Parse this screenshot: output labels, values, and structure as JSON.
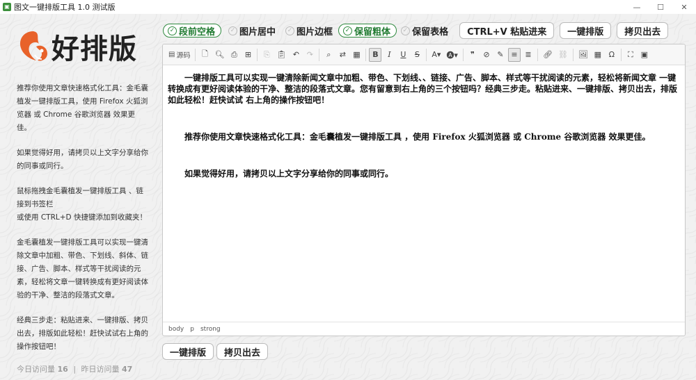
{
  "window": {
    "title": "图文一键排版工具 1.0 测试版",
    "minimize": "—",
    "maximize": "☐",
    "close": "✕"
  },
  "brand": {
    "logo_text": "好排版",
    "accent": "#e8622a"
  },
  "sidebar": {
    "paragraphs": [
      "推荐你使用文章快速格式化工具：金毛囊植发一键排版工具，使用 Firefox 火狐浏览器 或 Chrome 谷歌浏览器 效果更佳。",
      "如果觉得好用，请拷贝以上文字分享给你的同事或同行。",
      "鼠标拖拽金毛囊植发一键排版工具 、链接到书签栏\n或使用 CTRL+D 快捷键添加到收藏夹！",
      "金毛囊植发一键排版工具可以实现一键清除文章中加粗、带色、下划线、斜体、链接、广告、脚本、样式等干扰阅读的元素，轻松将文章一键转换成有更好阅读体验的干净、整洁的段落式文章。",
      "经典三步走：粘贴进来、一键排版、拷贝出去，排版如此轻松！赶快试试右上角的操作按钮吧！"
    ],
    "visits": {
      "today_label": "今日访问量",
      "today_value": "16",
      "separator": "|",
      "yesterday_label": "昨日访问量",
      "yesterday_value": "47"
    }
  },
  "options": [
    {
      "label": "段前空格",
      "checked": true
    },
    {
      "label": "图片居中",
      "checked": false
    },
    {
      "label": "图片边框",
      "checked": false
    },
    {
      "label": "保留粗体",
      "checked": true
    },
    {
      "label": "保留表格",
      "checked": false
    }
  ],
  "actions": {
    "paste": "CTRL+V 粘贴进来",
    "format": "一键排版",
    "copy": "拷贝出去"
  },
  "toolbar": {
    "source_label": "源码"
  },
  "document": {
    "paragraphs": [
      "一键排版工具可以实现一键清除新闻文章中加粗、带色、下划线、、链接、广告、脚本、样式等干扰阅读的元素，轻松将新闻文章 一键转换成有更好阅读体验的干净、整洁的段落式文章。您有留意到右上角的三个按钮吗？经典三步走。粘贴进来、一键排版、拷贝出去，排版如此轻松！赶快试试 右上角的操作按钮吧！",
      "推荐你使用文章快速格式化工具：金毛囊植发一键排版工具 ，使用 Firefox 火狐浏览器 或 Chrome 谷歌浏览器 效果更佳。",
      "如果觉得好用，请拷贝以上文字分享给你的同事或同行。"
    ]
  },
  "statusbar": {
    "path": [
      "body",
      "p",
      "strong"
    ]
  },
  "bottom_actions": {
    "format": "一键排版",
    "copy": "拷贝出去"
  },
  "colors": {
    "checked_green": "#2f8a3f"
  }
}
